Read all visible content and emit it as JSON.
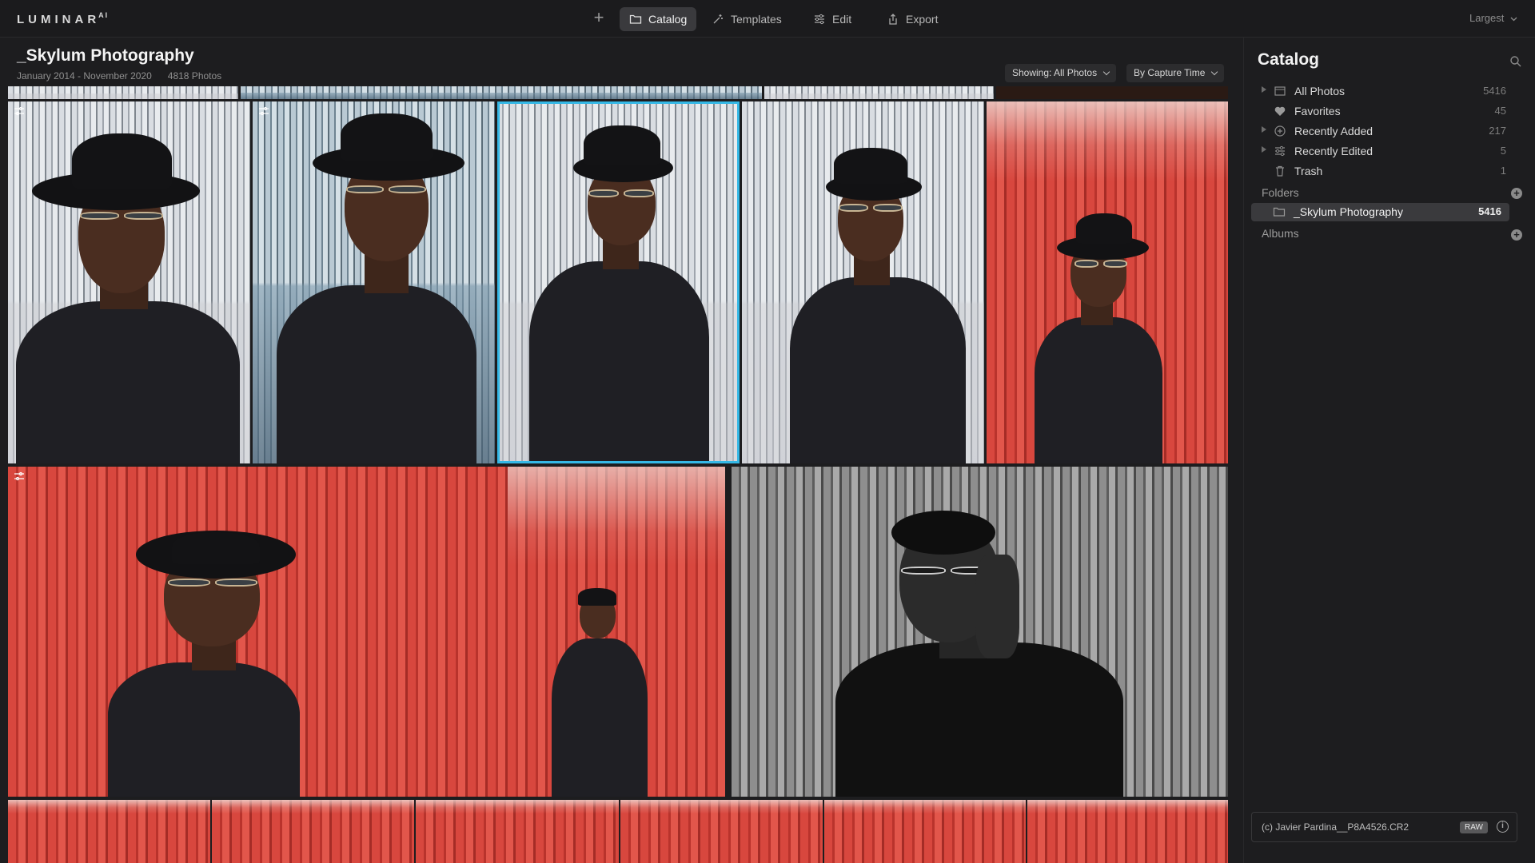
{
  "app": {
    "logo": "LUMINAR",
    "logo_suffix": "AI"
  },
  "topnav": {
    "tabs": [
      {
        "label": "Catalog",
        "icon": "folder-icon",
        "active": true
      },
      {
        "label": "Templates",
        "icon": "sparkle-wand-icon",
        "active": false
      },
      {
        "label": "Edit",
        "icon": "sliders-icon",
        "active": false
      },
      {
        "label": "Export",
        "icon": "share-icon",
        "active": false
      }
    ],
    "size_option": "Largest"
  },
  "header": {
    "title": "_Skylum Photography",
    "date_range": "January 2014 - November 2020",
    "photo_count": "4818 Photos",
    "showing_filter": "Showing: All Photos",
    "sort_filter": "By Capture Time"
  },
  "sidebar": {
    "title": "Catalog",
    "items": [
      {
        "label": "All Photos",
        "count": "5416",
        "icon": "photos-icon"
      },
      {
        "label": "Favorites",
        "count": "45",
        "icon": "heart-icon"
      },
      {
        "label": "Recently Added",
        "count": "217",
        "icon": "plus-circle-icon"
      },
      {
        "label": "Recently Edited",
        "count": "5",
        "icon": "sliders-icon"
      },
      {
        "label": "Trash",
        "count": "1",
        "icon": "trash-icon"
      }
    ],
    "folders_label": "Folders",
    "folder": {
      "label": "_Skylum Photography",
      "count": "5416"
    },
    "albums_label": "Albums"
  },
  "file_info": {
    "filename": "(c) Javier Pardina__P8A4526.CR2",
    "format_badge": "RAW"
  },
  "colors": {
    "accent_selected": "#35b8e6",
    "background": "#1d1d1f",
    "active_tab": "#3a3a3d"
  }
}
